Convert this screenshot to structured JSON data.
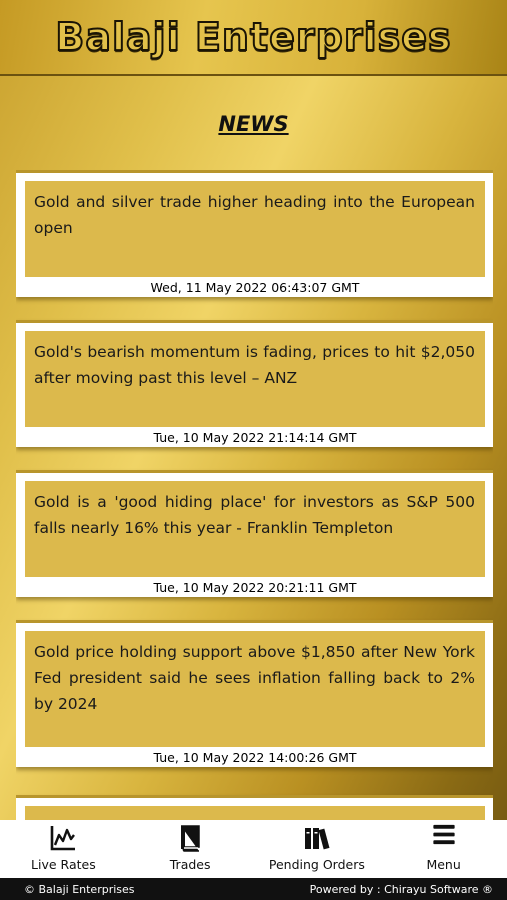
{
  "header": {
    "title": "Balaji Enterprises"
  },
  "page": {
    "heading": "NEWS"
  },
  "news": [
    {
      "text": "Gold and silver trade higher heading into the European open",
      "time": "Wed, 11 May 2022 06:43:07 GMT"
    },
    {
      "text": "Gold's bearish momentum is fading, prices to hit $2,050 after moving past this level – ANZ",
      "time": "Tue, 10 May 2022 21:14:14 GMT"
    },
    {
      "text": "Gold is a 'good hiding place' for investors as S&P 500 falls nearly 16% this year - Franklin Templeton",
      "time": "Tue, 10 May 2022 20:21:11 GMT"
    },
    {
      "text": "Gold price holding support above $1,850 after New York Fed president said he sees inflation falling back to 2% by 2024",
      "time": "Tue, 10 May 2022 14:00:26 GMT"
    }
  ],
  "nav": [
    {
      "label": "Live Rates",
      "icon": "line-chart-icon"
    },
    {
      "label": "Trades",
      "icon": "book-icon"
    },
    {
      "label": "Pending Orders",
      "icon": "books-icon"
    },
    {
      "label": "Menu",
      "icon": "hamburger-menu-icon"
    }
  ],
  "footer": {
    "copyright": "© Balaji Enterprises",
    "powered": "Powered by : Chirayu Software ®"
  }
}
